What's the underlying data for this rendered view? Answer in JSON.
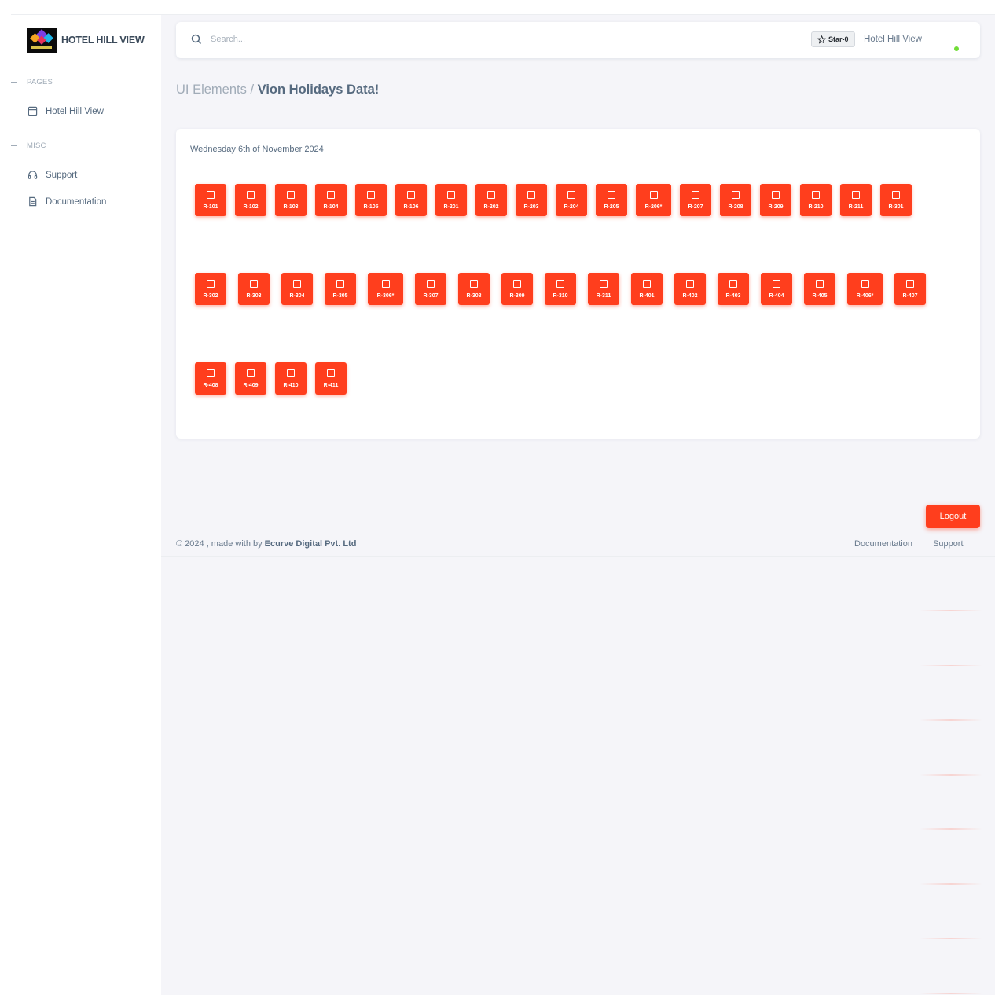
{
  "brand": {
    "name": "HOTEL HILL VIEW"
  },
  "sidebar": {
    "sections": [
      {
        "header": "PAGES",
        "items": [
          {
            "label": "Hotel Hill View",
            "icon": "layout-icon"
          }
        ]
      },
      {
        "header": "MISC",
        "items": [
          {
            "label": "Support",
            "icon": "headset-icon"
          },
          {
            "label": "Documentation",
            "icon": "document-icon"
          }
        ]
      }
    ]
  },
  "navbar": {
    "search_placeholder": "Search...",
    "star_label": "Star",
    "star_count": "0",
    "user_name": "Hotel Hill View"
  },
  "breadcrumb": {
    "parent": "UI Elements",
    "separator": " / ",
    "current": "Vion Holidays Data!"
  },
  "card": {
    "date": "Wednesday 6th of November 2024",
    "rooms": [
      [
        "R-101",
        "R-102",
        "R-103",
        "R-104",
        "R-105",
        "R-106",
        "R-201",
        "R-202",
        "R-203",
        "R-204",
        "R-205",
        "R-206*",
        "R-207",
        "R-208",
        "R-209",
        "R-210",
        "R-211",
        "R-301"
      ],
      [
        "R-302",
        "R-303",
        "R-304",
        "R-305",
        "R-306*",
        "R-307",
        "R-308",
        "R-309",
        "R-310",
        "R-311",
        "R-401",
        "R-402",
        "R-403",
        "R-404",
        "R-405",
        "R-406*",
        "R-407"
      ],
      [
        "R-408",
        "R-409",
        "R-410",
        "R-411"
      ]
    ],
    "room_color": "#ff3e1d"
  },
  "logout_label": "Logout",
  "footer": {
    "copyright_prefix": "© 2024 , made with by ",
    "company": "Ecurve Digital Pvt. Ltd",
    "links": [
      "Documentation",
      "Support"
    ]
  },
  "colors": {
    "accent": "#ff3e1d",
    "background": "#f5f5f9",
    "text": "#566a7f",
    "online": "#71dd37"
  }
}
